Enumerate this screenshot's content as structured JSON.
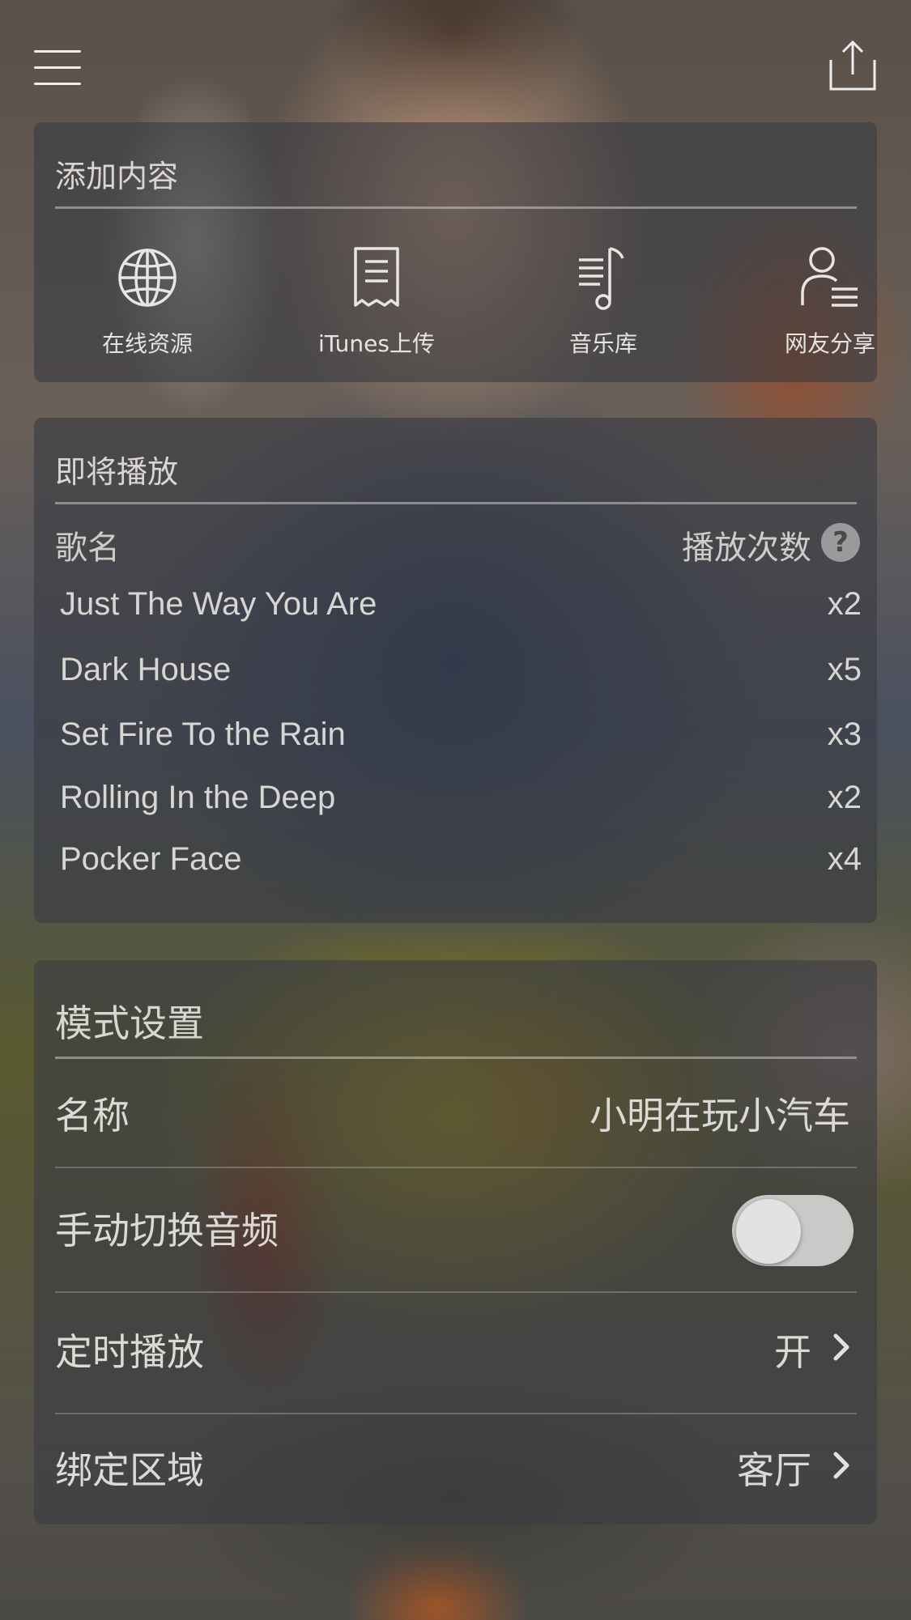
{
  "colors": {
    "card_bg": "#3a3c42",
    "text": "#dcdad6",
    "divider": "#c8c8c8"
  },
  "toolbar": {
    "menu_icon": "hamburger-menu-icon",
    "share_icon": "share-upload-icon"
  },
  "add_content": {
    "title": "添加内容",
    "items": [
      {
        "label": "在线资源",
        "icon": "globe-icon"
      },
      {
        "label": "iTunes上传",
        "icon": "receipt-document-icon"
      },
      {
        "label": "音乐库",
        "icon": "music-list-icon"
      },
      {
        "label": "网友分享",
        "icon": "user-list-icon"
      }
    ]
  },
  "upcoming": {
    "title": "即将播放",
    "col_song": "歌名",
    "col_count": "播放次数",
    "help": "?",
    "songs": [
      {
        "name": "Just The Way You Are",
        "count": "x2"
      },
      {
        "name": "Dark House",
        "count": "x5"
      },
      {
        "name": "Set Fire To the Rain",
        "count": "x3"
      },
      {
        "name": "Rolling In the Deep",
        "count": "x2"
      },
      {
        "name": "Pocker Face",
        "count": "x4"
      }
    ]
  },
  "mode_settings": {
    "title": "模式设置",
    "name_label": "名称",
    "name_value": "小明在玩小汽车",
    "manual_switch_label": "手动切换音频",
    "manual_switch_on": false,
    "timed_play_label": "定时播放",
    "timed_play_value": "开",
    "bind_area_label": "绑定区域",
    "bind_area_value": "客厅"
  }
}
